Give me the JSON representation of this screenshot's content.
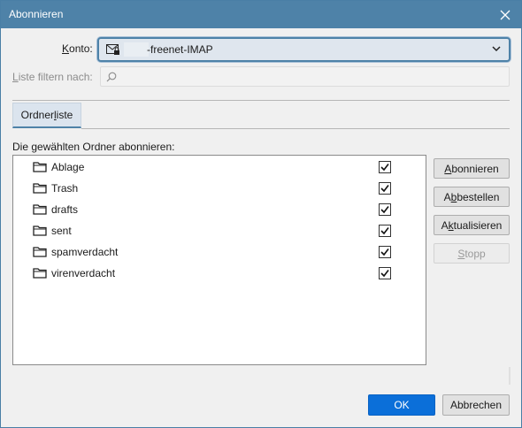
{
  "window": {
    "title": "Abonnieren"
  },
  "account": {
    "label": "Konto:",
    "label_underline_index": 0,
    "value": "-freenet-IMAP"
  },
  "filter": {
    "label": "Liste filtern nach:",
    "value": "",
    "placeholder": ""
  },
  "tab": {
    "label": "Ordnerliste"
  },
  "list": {
    "heading": "Die gewählten Ordner abonnieren:",
    "folders": [
      {
        "name": "Ablage",
        "checked": true
      },
      {
        "name": "Trash",
        "checked": true
      },
      {
        "name": "drafts",
        "checked": true
      },
      {
        "name": "sent",
        "checked": true
      },
      {
        "name": "spamverdacht",
        "checked": true
      },
      {
        "name": "virenverdacht",
        "checked": true
      }
    ]
  },
  "actions": {
    "subscribe": "Abonnieren",
    "unsubscribe": "Abbestellen",
    "refresh": "Aktualisieren",
    "stop": "Stopp"
  },
  "footer": {
    "ok": "OK",
    "cancel": "Abbrechen"
  },
  "colors": {
    "titlebar": "#4e82a8",
    "accent": "#0b6fd9",
    "focus_border": "#4e82a8"
  },
  "icons": {
    "close": "close-icon",
    "account": "mail-account-icon",
    "dropdown": "chevron-down-icon",
    "search": "search-icon",
    "folder": "folder-icon",
    "checkbox": "checkbox-checked-icon"
  }
}
